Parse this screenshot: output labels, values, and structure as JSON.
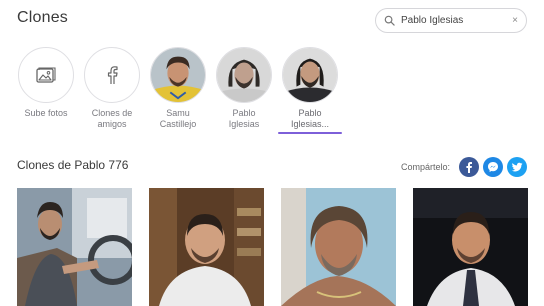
{
  "header": {
    "title": "Clones"
  },
  "search": {
    "value": "Pablo Iglesias",
    "clear_symbol": "×"
  },
  "circles": [
    {
      "label_1": "Sube fotos",
      "label_2": "",
      "icon": "image-icon"
    },
    {
      "label_1": "Clones de",
      "label_2": "amigos",
      "icon": "facebook-icon"
    },
    {
      "label_1": "Samu",
      "label_2": "Castillejo"
    },
    {
      "label_1": "Pablo",
      "label_2": "Iglesias"
    },
    {
      "label_1": "Pablo",
      "label_2": "Iglesias...",
      "active": true
    }
  ],
  "section": {
    "title": "Clones de Pablo 776"
  },
  "share": {
    "label": "Compártelo:",
    "facebook": "f",
    "messenger": "m",
    "twitter": "t"
  },
  "colors": {
    "accent": "#7d5fd9",
    "facebook": "#3b5998",
    "messenger": "#1e88e5",
    "twitter": "#1da1f2"
  }
}
